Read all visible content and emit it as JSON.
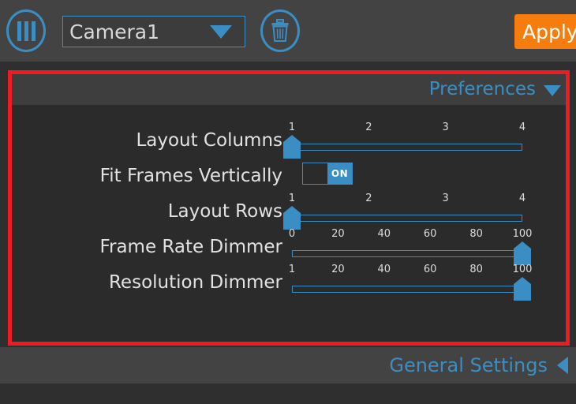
{
  "toolbar": {
    "layout_icon": "columns-layout-icon",
    "camera_select": {
      "value": "Camera1",
      "arrow_icon": "chevron-down-icon"
    },
    "delete_icon": "trash-icon",
    "apply_label": "Apply"
  },
  "preferences": {
    "title": "Preferences",
    "chevron_icon": "chevron-down-icon",
    "rows": [
      {
        "label": "Layout Columns",
        "type": "slider",
        "ticks": [
          "1",
          "2",
          "3",
          "4"
        ],
        "value": 1,
        "min": 1,
        "max": 4
      },
      {
        "label": "Fit Frames Vertically",
        "type": "toggle",
        "state": "ON"
      },
      {
        "label": "Layout Rows",
        "type": "slider",
        "ticks": [
          "1",
          "2",
          "3",
          "4"
        ],
        "value": 1,
        "min": 1,
        "max": 4
      },
      {
        "label": "Frame Rate Dimmer",
        "type": "slider",
        "ticks": [
          "0",
          "20",
          "40",
          "60",
          "80",
          "100"
        ],
        "value": 100,
        "min": 0,
        "max": 100
      },
      {
        "label": "Resolution Dimmer",
        "type": "slider",
        "ticks": [
          "1",
          "20",
          "40",
          "60",
          "80",
          "100"
        ],
        "value": 100,
        "min": 1,
        "max": 100
      }
    ]
  },
  "footer": {
    "general_settings_label": "General Settings",
    "chevron_icon": "chevron-left-icon"
  },
  "colors": {
    "accent_blue": "#3a8ec4",
    "apply_orange": "#f57c0d",
    "highlight_red": "#ed1c24",
    "panel_bg": "#2b2b2b",
    "toolbar_bg": "#434343"
  }
}
